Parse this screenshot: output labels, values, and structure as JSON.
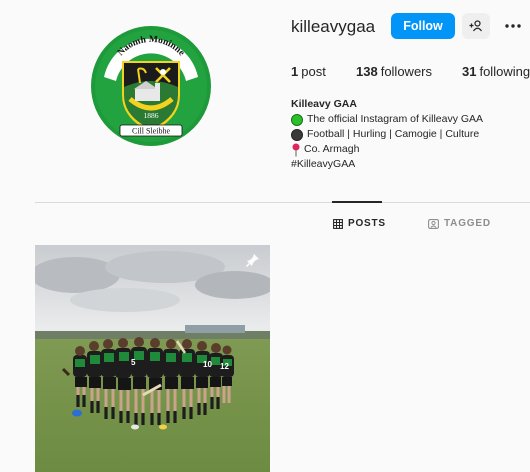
{
  "profile": {
    "username": "killeavygaa",
    "display_name": "Killeavy GAA",
    "avatar_icon": "club-crest-icon",
    "avatar_text": {
      "top": "Naomh Moninne",
      "year": "1886",
      "bottom": "Cill Sleibhe"
    }
  },
  "actions": {
    "follow_label": "Follow",
    "add_user_icon": "add-user-icon",
    "more_icon": "more-options-icon"
  },
  "stats": {
    "posts_count": "1",
    "posts_label": "post",
    "followers_count": "138",
    "followers_label": "followers",
    "following_count": "31",
    "following_label": "following"
  },
  "bio": {
    "line1": "The official Instagram of Killeavy GAA",
    "line2": "Football | Hurling | Camogie | Culture",
    "line3": "Co. Armagh",
    "line4": "#KilleavyGAA"
  },
  "tabs": [
    {
      "label": "POSTS",
      "icon": "grid-icon",
      "active": true
    },
    {
      "label": "TAGGED",
      "icon": "tagged-icon",
      "active": false
    }
  ],
  "posts": [
    {
      "pinned": true,
      "icon": "pin-icon"
    }
  ],
  "colors": {
    "follow_blue": "#0095f6",
    "crest_green": "#1e9a3a",
    "crest_yellow": "#f5d21e"
  }
}
